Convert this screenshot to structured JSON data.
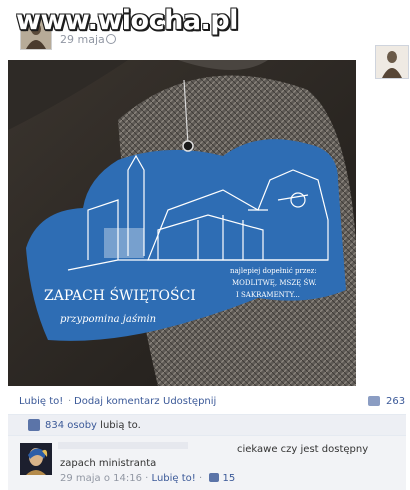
{
  "watermark": "www.wiocha.pl",
  "post": {
    "time": "29 maja",
    "photo": {
      "tag_title": "ZAPACH ŚWIĘTOŚCI",
      "tag_subtitle": "przypomina jaśmin",
      "tag_side_1": "najlepiej dopełnić przez:",
      "tag_side_2": "MODLITWĘ, MSZĘ ŚW.",
      "tag_side_3": "I SAKRAMENTY..."
    }
  },
  "actions": {
    "like": "Lubię to!",
    "dot1": "·",
    "comment": "Dodaj komentarz",
    "dot2": "·",
    "share": "Udostępnij",
    "comment_count": "263"
  },
  "likes": {
    "count_text": "834 osoby",
    "suffix": "lubią to."
  },
  "comment": {
    "text_line1": "ciekawe czy jest dostępny",
    "text_line2": "zapach ministranta",
    "time": "29 maja o 14:16",
    "sep": "·",
    "like_label": "Lubię to!",
    "sep2": "·",
    "like_count": "15"
  },
  "colors": {
    "link": "#3b5998",
    "meta": "#9197a3",
    "tag_blue": "#2e6db4"
  }
}
